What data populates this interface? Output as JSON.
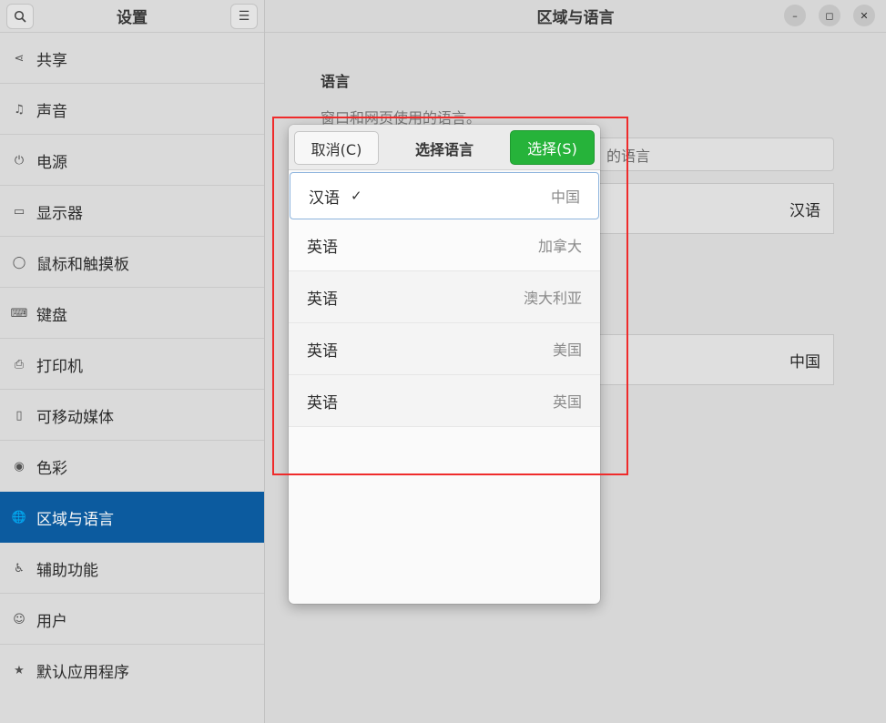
{
  "sidebar": {
    "title": "设置",
    "items": [
      {
        "label": "共享",
        "icon": "share-icon",
        "glyph": "⋖"
      },
      {
        "label": "声音",
        "icon": "music-note-icon",
        "glyph": "♫"
      },
      {
        "label": "电源",
        "icon": "power-icon",
        "glyph": "⏻"
      },
      {
        "label": "显示器",
        "icon": "monitor-icon",
        "glyph": "▭"
      },
      {
        "label": "鼠标和触摸板",
        "icon": "mouse-icon",
        "glyph": "◯"
      },
      {
        "label": "键盘",
        "icon": "keyboard-icon",
        "glyph": "⌨"
      },
      {
        "label": "打印机",
        "icon": "printer-icon",
        "glyph": "⎙"
      },
      {
        "label": "可移动媒体",
        "icon": "removable-media-icon",
        "glyph": "▯"
      },
      {
        "label": "色彩",
        "icon": "color-icon",
        "glyph": "◉"
      },
      {
        "label": "区域与语言",
        "icon": "globe-icon",
        "glyph": "🌐"
      },
      {
        "label": "辅助功能",
        "icon": "accessibility-icon",
        "glyph": "♿"
      },
      {
        "label": "用户",
        "icon": "user-icon",
        "glyph": "☺"
      },
      {
        "label": "默认应用程序",
        "icon": "star-icon",
        "glyph": "★"
      }
    ],
    "active_index": 9
  },
  "main": {
    "title": "区域与语言",
    "section_title": "语言",
    "section_subtitle": "窗口和网页使用的语言。",
    "field_text": "的语言",
    "language_value": "汉语",
    "format_value": "中国"
  },
  "dialog": {
    "cancel_label": "取消(C)",
    "title": "选择语言",
    "select_label": "选择(S)",
    "languages": [
      {
        "name": "汉语",
        "region": "中国",
        "checked": true
      },
      {
        "name": "英语",
        "region": "加拿大",
        "checked": false
      },
      {
        "name": "英语",
        "region": "澳大利亚",
        "checked": false
      },
      {
        "name": "英语",
        "region": "美国",
        "checked": false
      },
      {
        "name": "英语",
        "region": "英国",
        "checked": false
      }
    ],
    "check_glyph": "✓"
  },
  "colors": {
    "accent": "#0d5ea5",
    "select_button": "#26b33a",
    "annotation": "#ef2b2b"
  }
}
